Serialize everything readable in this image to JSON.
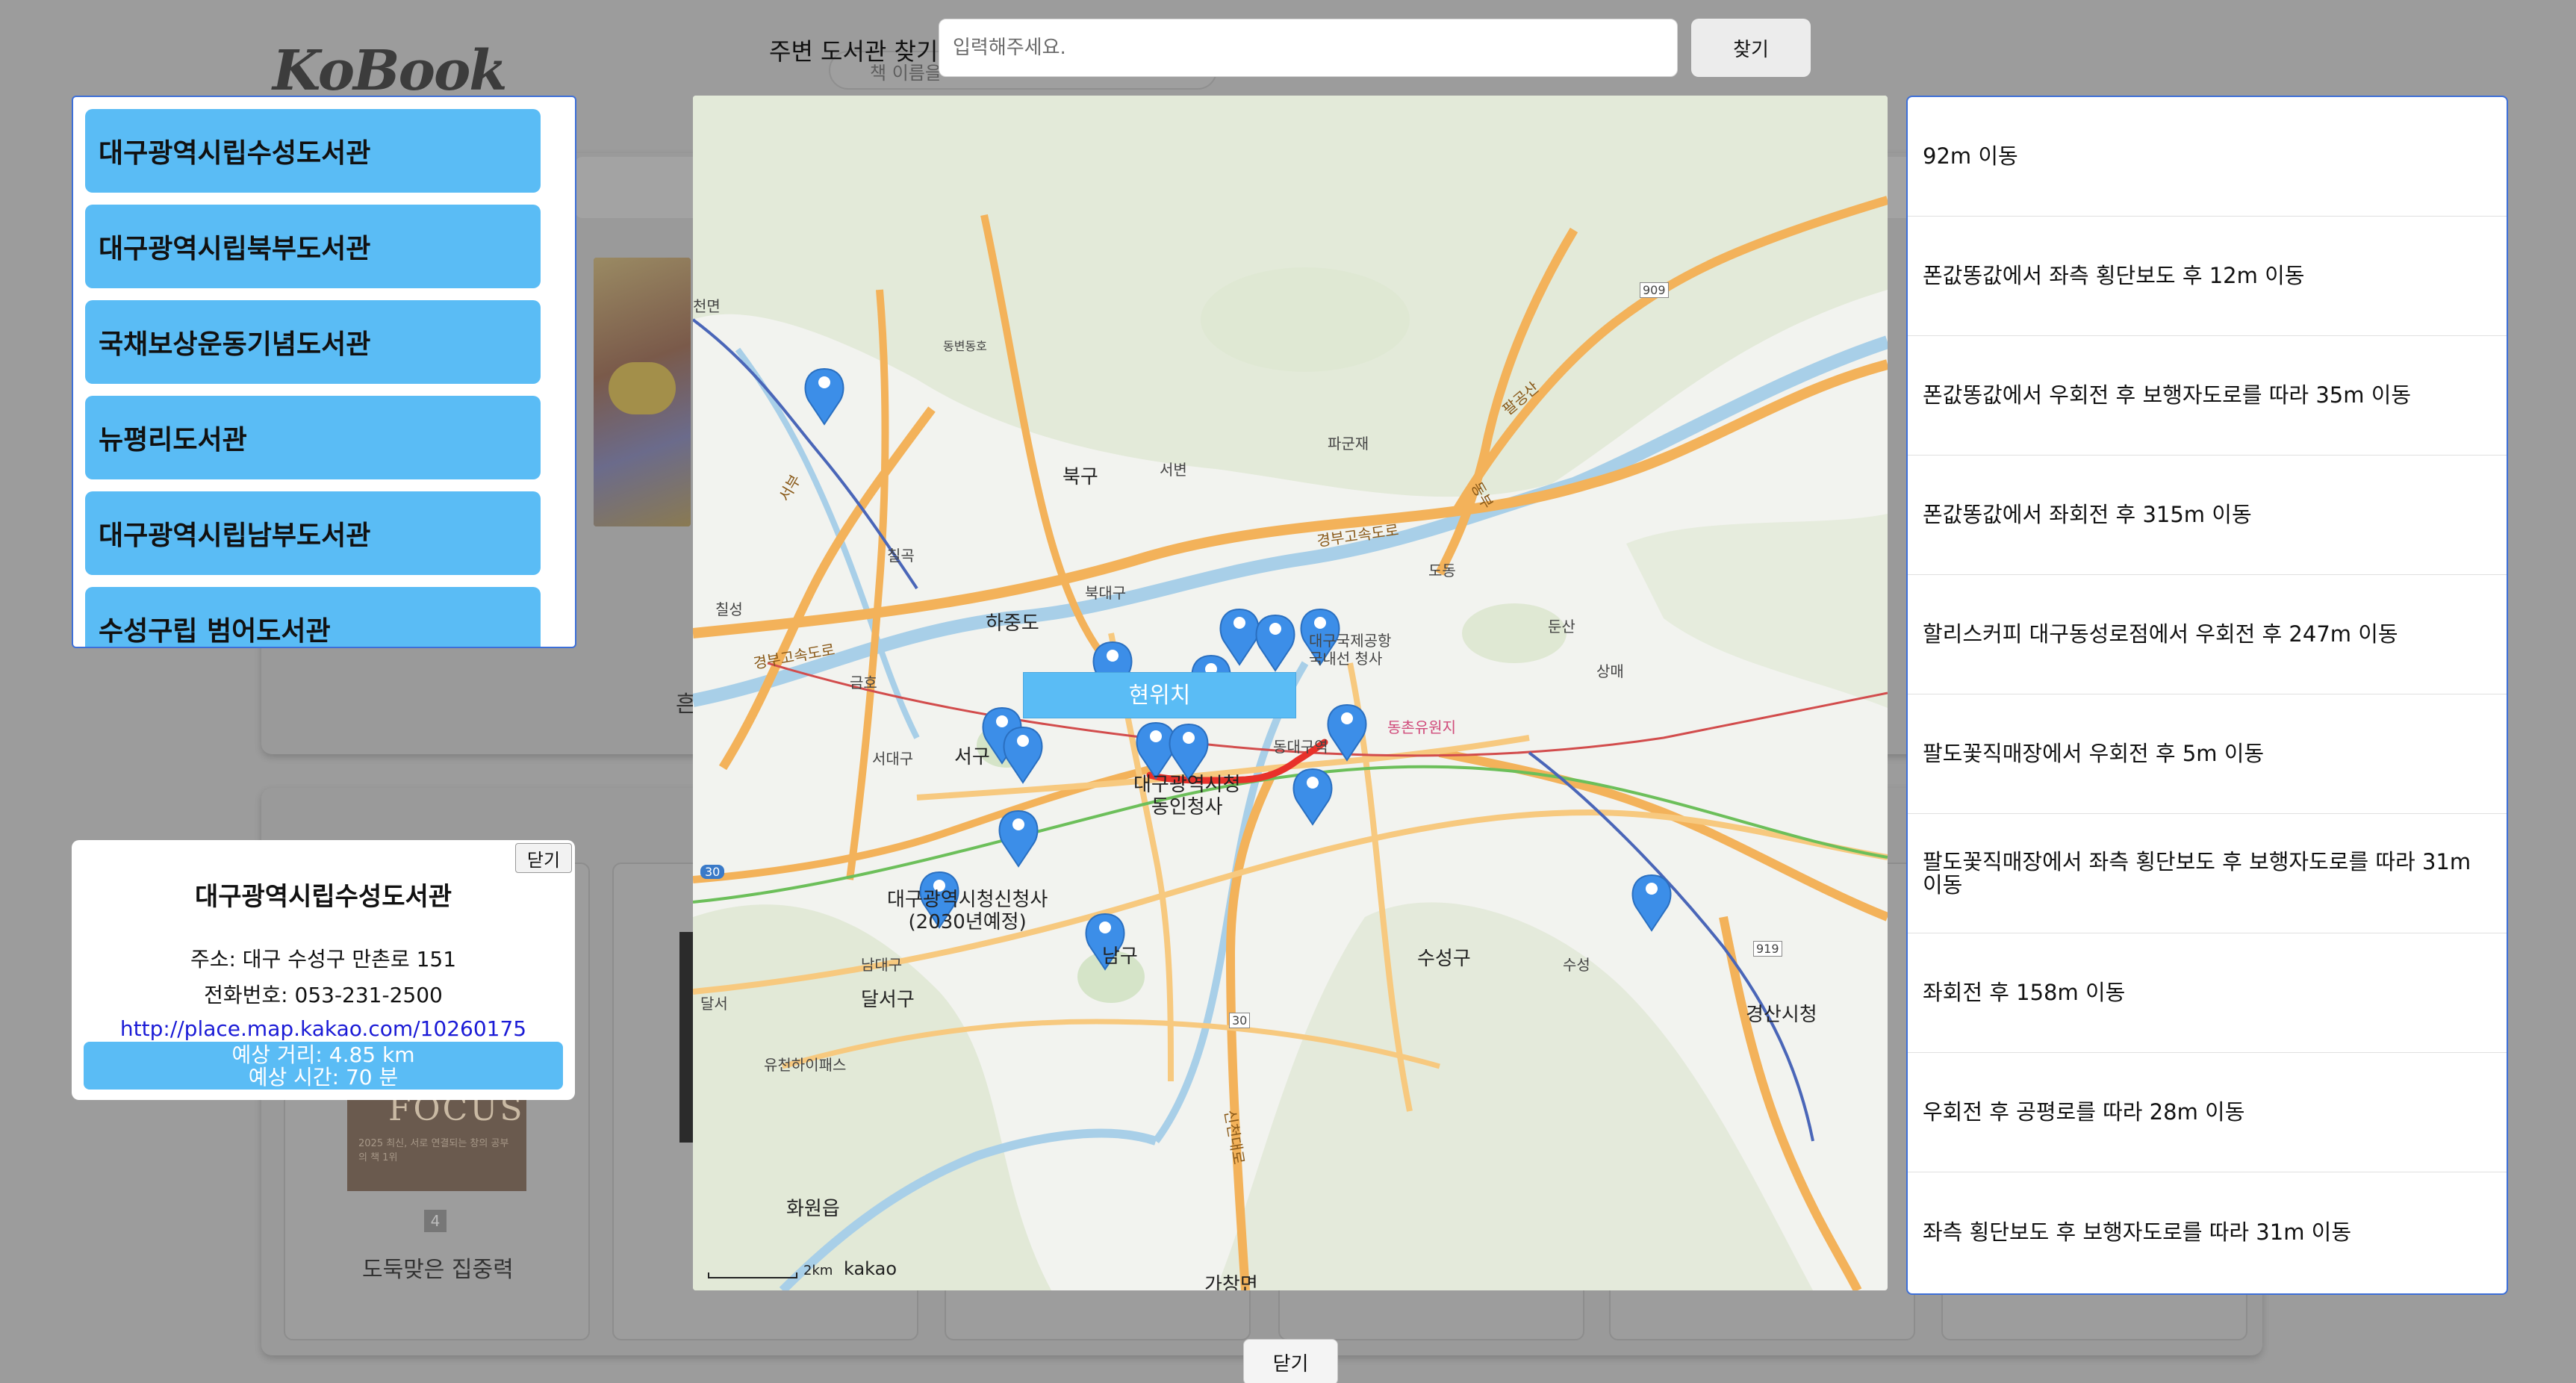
{
  "background": {
    "logo": "KoBook",
    "search_placeholder": "책 이름을",
    "fragment_text": "흔",
    "book_rank": "4",
    "book_cover_text": "FOCUS",
    "book_cover_subtitle": "2025 최신, 서로 연결되는 창의 공부의 책 1위",
    "book_title": "도둑맞은 집중력"
  },
  "search": {
    "label": "주변 도서관 찾기",
    "placeholder": "입력해주세요.",
    "button": "찾기"
  },
  "libraries": [
    "대구광역시립수성도서관",
    "대구광역시립북부도서관",
    "국채보상운동기념도서관",
    "뉴평리도서관",
    "대구광역시립남부도서관",
    "수성구립 범어도서관"
  ],
  "selected": {
    "close": "닫기",
    "name": "대구광역시립수성도서관",
    "address": "주소: 대구 수성구 만촌로 151",
    "phone": "전화번호: 053-231-2500",
    "link": "http://place.map.kakao.com/10260175",
    "distance": "예상 거리: 4.85 km",
    "time": "예상 시간: 70 분"
  },
  "map": {
    "current_location": "현위치",
    "scale": "2km",
    "brand": "kakao",
    "labels": {
      "cheonmyeon": "천면",
      "dongbyeon": "동변동호",
      "chilgok": "칠곡",
      "bukgu": "북구",
      "seobyeon": "서변",
      "pagunjae": "파군재",
      "hajungdo": "하중도",
      "bukdaegu": "북대구",
      "seogu": "서구",
      "seodaegu": "서대구",
      "geumho": "금호",
      "dongdaegu": "동대구역",
      "city_hall": "대구광역시청\n동인청사",
      "new_hall": "대구광역시청신청사\n(2030년예정)",
      "namgu": "남구",
      "suseonggu": "수성구",
      "dalseo": "달서",
      "dalseogu": "달서구",
      "namdaegu": "남대구",
      "yuchun": "유천하이패스",
      "hwawon": "화원읍",
      "gachang": "가창면",
      "gyeongsan": "경산시청",
      "suseong_ic": "수성",
      "dongchon": "동촌유원지",
      "airport": "대구국제공항\n국내선 청사",
      "dundo": "도동",
      "dunsan": "둔산",
      "sangmae": "상매",
      "chilseong": "칠성",
      "gyeongbu": "경부고속도로",
      "shinchon": "신천대로",
      "palgong": "팔공산",
      "seobu": "서부",
      "dongbu": "동부",
      "route_909": "909",
      "route_30": "30",
      "route_919": "919",
      "chilgok_ic": "칠곡"
    }
  },
  "directions": [
    "92m 이동",
    "폰값똥값에서 좌측 횡단보도 후 12m 이동",
    "폰값똥값에서 우회전 후 보행자도로를 따라 35m 이동",
    "폰값똥값에서 좌회전 후 315m 이동",
    "할리스커피 대구동성로점에서 우회전 후 247m 이동",
    "팔도꽃직매장에서 우회전 후 5m 이동",
    "팔도꽃직매장에서 좌측 횡단보도 후 보행자도로를 따라 31m 이동",
    "좌회전 후 158m 이동",
    "우회전 후 공평로를 따라 28m 이동",
    "좌측 횡단보도 후 보행자도로를 따라 31m 이동"
  ],
  "footer": {
    "close": "닫기"
  },
  "colors": {
    "accent": "#5abcf5",
    "border": "#3d6fd8",
    "marker": "#3c8ee8",
    "route": "#e8312a"
  }
}
